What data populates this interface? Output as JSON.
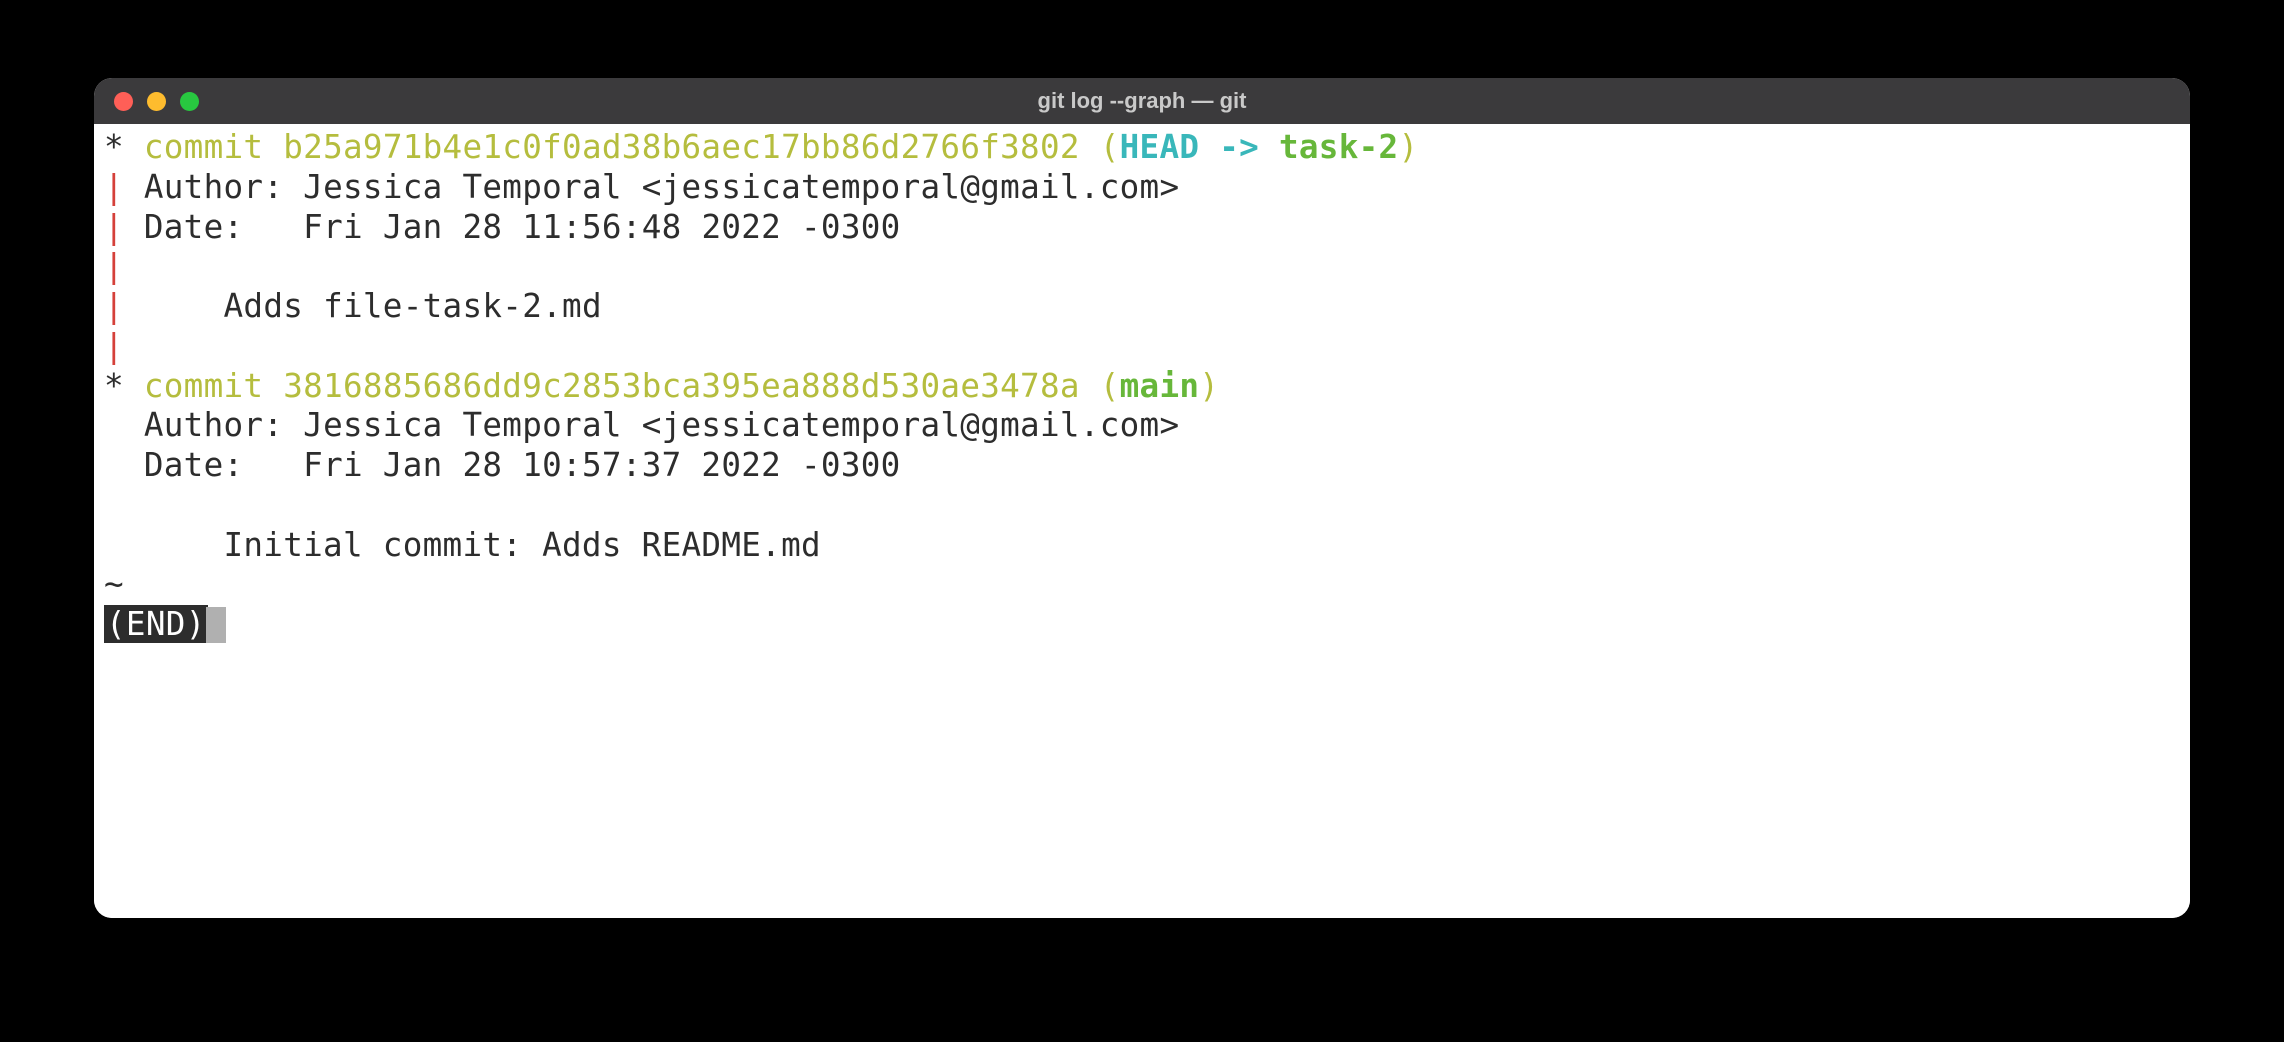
{
  "window": {
    "title": "git log --graph — git"
  },
  "commits": [
    {
      "graph_star": "*",
      "graph_pipe": "|",
      "commit_word": "commit",
      "hash": "b25a971b4e1c0f0ad38b6aec17bb86d2766f3802",
      "refs_open": " (",
      "head": "HEAD -> ",
      "branch": "task-2",
      "refs_close": ")",
      "author_label": "Author:",
      "author_value": "Jessica Temporal <jessicatemporal@gmail.com>",
      "date_label": "Date:",
      "date_value": "Fri Jan 28 11:56:48 2022 -0300",
      "message": "Adds file-task-2.md"
    },
    {
      "graph_star": "*",
      "commit_word": "commit",
      "hash": "3816885686dd9c2853bca395ea888d530ae3478a",
      "refs_open": " (",
      "branch": "main",
      "refs_close": ")",
      "author_label": "Author:",
      "author_value": "Jessica Temporal <jessicatemporal@gmail.com>",
      "date_label": "Date:",
      "date_value": "Fri Jan 28 10:57:37 2022 -0300",
      "message": "Initial commit: Adds README.md"
    }
  ],
  "pager": {
    "tilde": "~",
    "end": "(END)"
  }
}
